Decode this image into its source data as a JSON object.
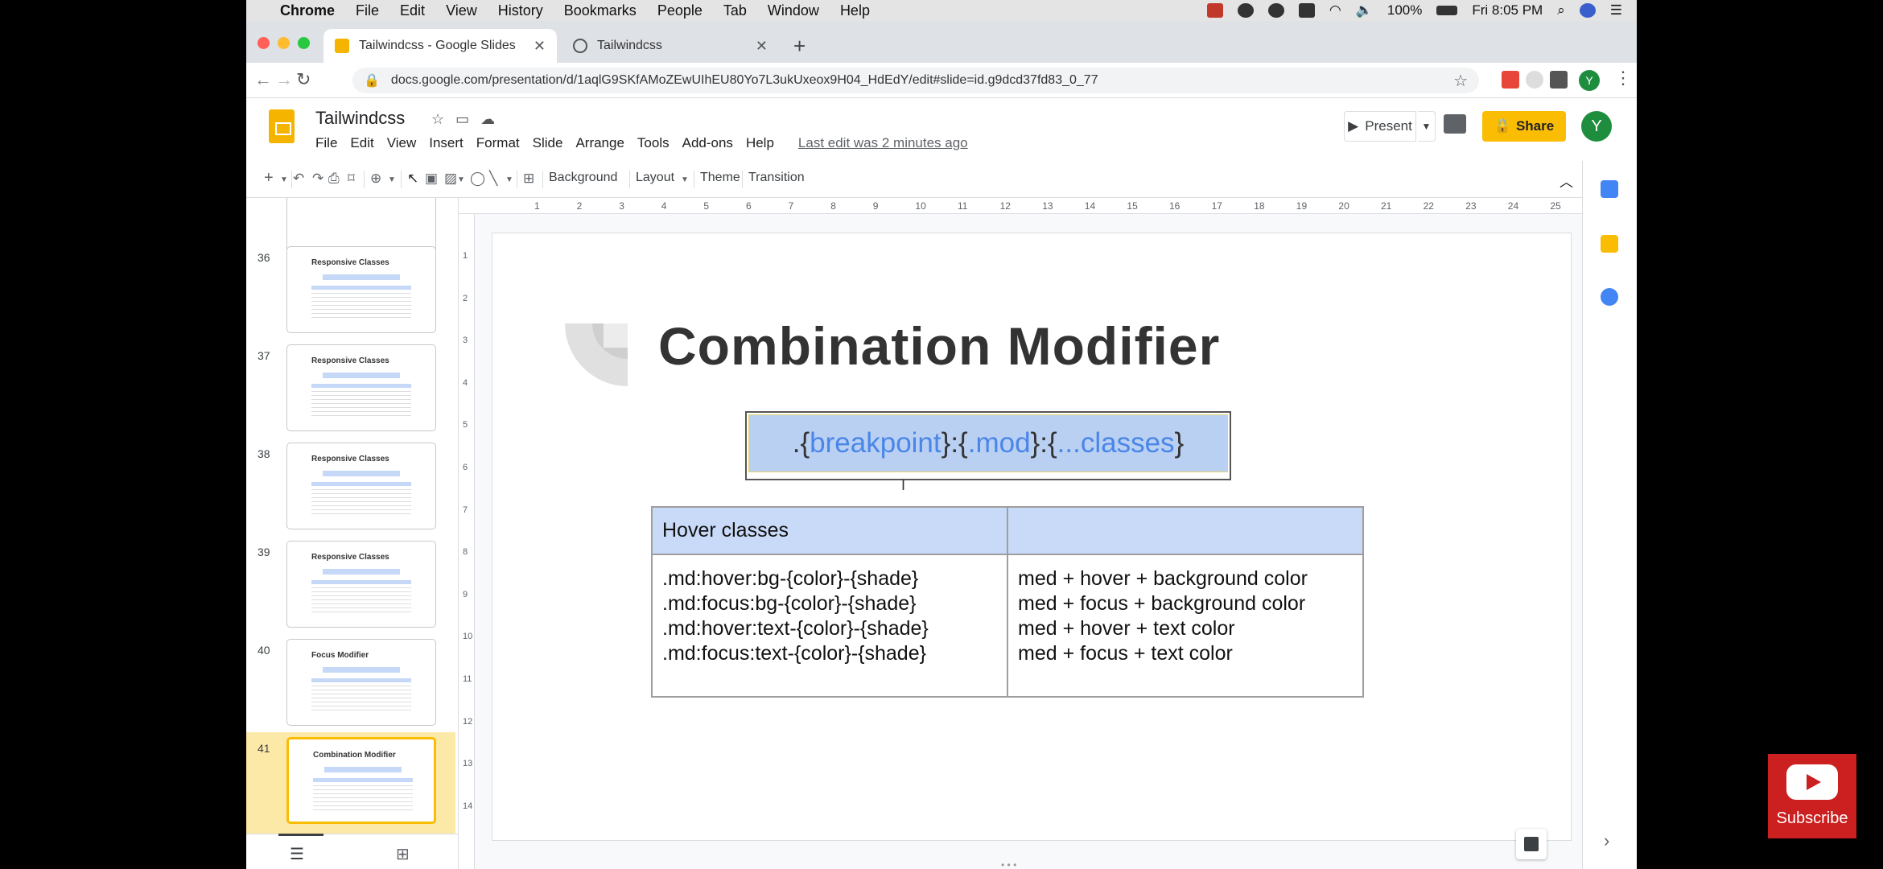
{
  "menubar": {
    "app": "Chrome",
    "items": [
      "File",
      "Edit",
      "View",
      "History",
      "Bookmarks",
      "People",
      "Tab",
      "Window",
      "Help"
    ],
    "battery": "100%",
    "clock": "Fri 8:05 PM"
  },
  "browser": {
    "tabs": [
      {
        "title": "Tailwindcss - Google Slides",
        "icon": "slides-icon"
      },
      {
        "title": "Tailwindcss",
        "icon": "globe-icon"
      }
    ],
    "url": "docs.google.com/presentation/d/1aqlG9SKfAMoZEwUIhEU80Yo7L3ukUxeox9H04_HdEdY/edit#slide=id.g9dcd37fd83_0_77",
    "profile_initial": "Y"
  },
  "doc": {
    "title": "Tailwindcss",
    "menu": [
      "File",
      "Edit",
      "View",
      "Insert",
      "Format",
      "Slide",
      "Arrange",
      "Tools",
      "Add-ons",
      "Help"
    ],
    "last_edit": "Last edit was 2 minutes ago",
    "present_label": "Present",
    "share_label": "Share",
    "avatar_initial": "Y"
  },
  "toolbar": {
    "background": "Background",
    "layout": "Layout",
    "theme": "Theme",
    "transition": "Transition"
  },
  "ruler": {
    "top": [
      "1",
      "2",
      "3",
      "4",
      "5",
      "6",
      "7",
      "8",
      "9",
      "10",
      "11",
      "12",
      "13",
      "14",
      "15",
      "16",
      "17",
      "18",
      "19",
      "20",
      "21",
      "22",
      "23",
      "24",
      "25"
    ],
    "left": [
      "1",
      "2",
      "3",
      "4",
      "5",
      "6",
      "7",
      "8",
      "9",
      "10",
      "11",
      "12",
      "13",
      "14"
    ]
  },
  "filmstrip": [
    {
      "num": "36",
      "title": "Responsive Classes"
    },
    {
      "num": "37",
      "title": "Responsive Classes"
    },
    {
      "num": "38",
      "title": "Responsive Classes"
    },
    {
      "num": "39",
      "title": "Responsive Classes"
    },
    {
      "num": "40",
      "title": "Focus Modifier"
    },
    {
      "num": "41",
      "title": "Combination Modifier"
    }
  ],
  "slide": {
    "title": "Combination Modifier",
    "code": [
      {
        "text": ".{",
        "style": "d"
      },
      {
        "text": "breakpoint",
        "style": "b"
      },
      {
        "text": "}:{",
        "style": "d"
      },
      {
        "text": ".mod",
        "style": "b"
      },
      {
        "text": "}:{",
        "style": "d"
      },
      {
        "text": "...classes",
        "style": "b"
      },
      {
        "text": "}",
        "style": "d"
      }
    ],
    "table": {
      "header": [
        "Hover classes",
        ""
      ],
      "left": [
        ".md:hover:bg-{color}-{shade}",
        ".md:focus:bg-{color}-{shade}",
        ".md:hover:text-{color}-{shade}",
        ".md:focus:text-{color}-{shade}"
      ],
      "right": [
        "med + hover + background color",
        "med + focus + background color",
        "med + hover + text color",
        "med + focus + text color"
      ]
    }
  },
  "overlay": {
    "subscribe": "Subscribe"
  },
  "colors": {
    "accent_yellow": "#fbbc04",
    "code_blue": "#4a86e8",
    "table_header": "#c9daf8",
    "youtube_red": "#cc1f1f"
  }
}
